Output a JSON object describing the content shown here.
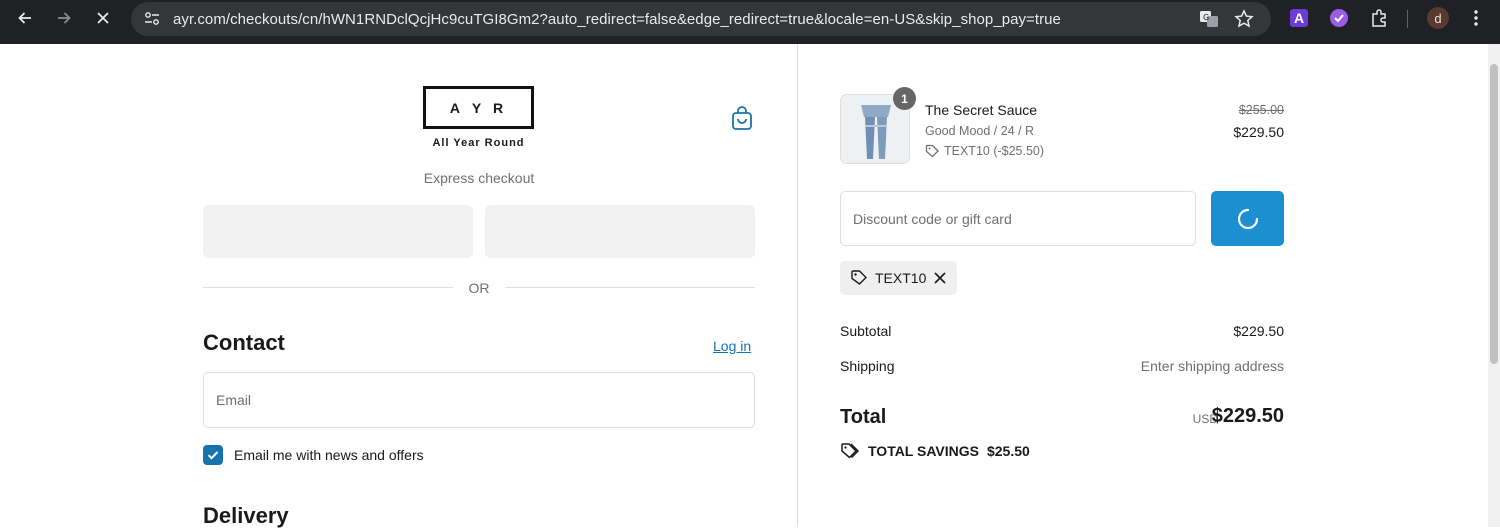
{
  "browser": {
    "url": "ayr.com/checkouts/cn/hWN1RNDclQcjHc9cuTGI8Gm2?auto_redirect=false&edge_redirect=true&locale=en-US&skip_shop_pay=true",
    "extension_a_label": "A",
    "profile_initial": "d"
  },
  "brand": {
    "logo_letters": [
      "A",
      "Y",
      "R"
    ],
    "tagline": "All Year Round"
  },
  "checkout": {
    "express_label": "Express checkout",
    "or_label": "OR",
    "contact_heading": "Contact",
    "login_label": "Log in",
    "email_placeholder": "Email",
    "newsletter_label": "Email me with news and offers",
    "newsletter_checked": true,
    "delivery_heading": "Delivery"
  },
  "order": {
    "item": {
      "quantity": "1",
      "name": "The Secret Sauce",
      "variant": "Good Mood / 24 / R",
      "discount": "TEXT10 (-$25.50)",
      "original_price": "$255.00",
      "price": "$229.50"
    },
    "discount_placeholder": "Discount code or gift card",
    "applied_code": "TEXT10",
    "subtotal_label": "Subtotal",
    "subtotal_value": "$229.50",
    "shipping_label": "Shipping",
    "shipping_value": "Enter shipping address",
    "total_label": "Total",
    "currency": "USD",
    "total_value": "$229.50",
    "savings_label": "TOTAL SAVINGS",
    "savings_value": "$25.50"
  },
  "colors": {
    "accent": "#1773b0",
    "apply_button": "#1b8fd0",
    "chrome_bg": "#202124"
  }
}
